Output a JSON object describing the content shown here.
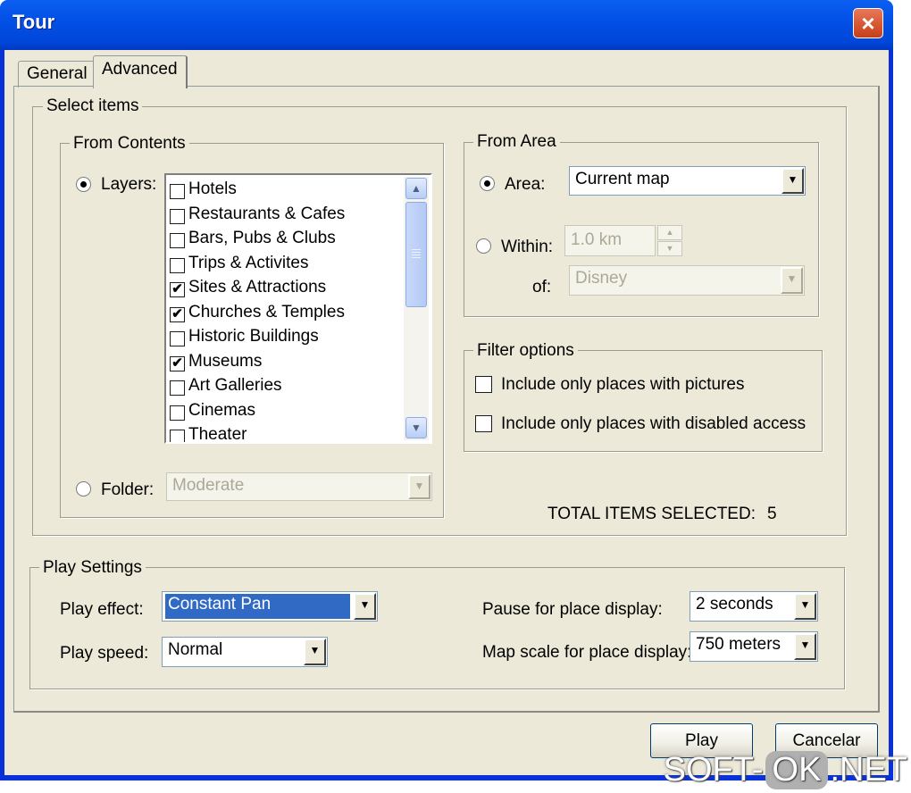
{
  "window": {
    "title": "Tour"
  },
  "tabs": [
    {
      "label": "General"
    },
    {
      "label": "Advanced"
    }
  ],
  "select_items": {
    "title": "Select items",
    "from_contents": {
      "title": "From Contents",
      "layers_label": "Layers:",
      "layers": [
        {
          "label": "Hotels",
          "checked": false
        },
        {
          "label": "Restaurants & Cafes",
          "checked": false
        },
        {
          "label": "Bars, Pubs & Clubs",
          "checked": false
        },
        {
          "label": "Trips & Activites",
          "checked": false
        },
        {
          "label": "Sites & Attractions",
          "checked": true
        },
        {
          "label": "Churches & Temples",
          "checked": true
        },
        {
          "label": "Historic Buildings",
          "checked": false
        },
        {
          "label": "Museums",
          "checked": true
        },
        {
          "label": "Art Galleries",
          "checked": false
        },
        {
          "label": "Cinemas",
          "checked": false
        },
        {
          "label": "Theater",
          "checked": false
        }
      ],
      "folder_label": "Folder:",
      "folder_value": "Moderate"
    },
    "from_area": {
      "title": "From Area",
      "area_label": "Area:",
      "area_value": "Current map",
      "within_label": "Within:",
      "within_value": "1.0 km",
      "of_label": "of:",
      "of_value": "Disney"
    },
    "filter_options": {
      "title": "Filter options",
      "pictures_label": "Include only places with pictures",
      "disabled_label": "Include only places with disabled access"
    },
    "total_label": "TOTAL ITEMS SELECTED:",
    "total_value": "5"
  },
  "play_settings": {
    "title": "Play Settings",
    "effect_label": "Play effect:",
    "effect_value": "Constant Pan",
    "speed_label": "Play speed:",
    "speed_value": "Normal",
    "pause_label": "Pause for place display:",
    "pause_value": "2 seconds",
    "scale_label": "Map scale for place display:",
    "scale_value": "750 meters"
  },
  "buttons": {
    "play": "Play",
    "cancel": "Cancelar"
  },
  "watermark": {
    "left": "SOFT-",
    "mid": "OK",
    "right": ".NET"
  }
}
